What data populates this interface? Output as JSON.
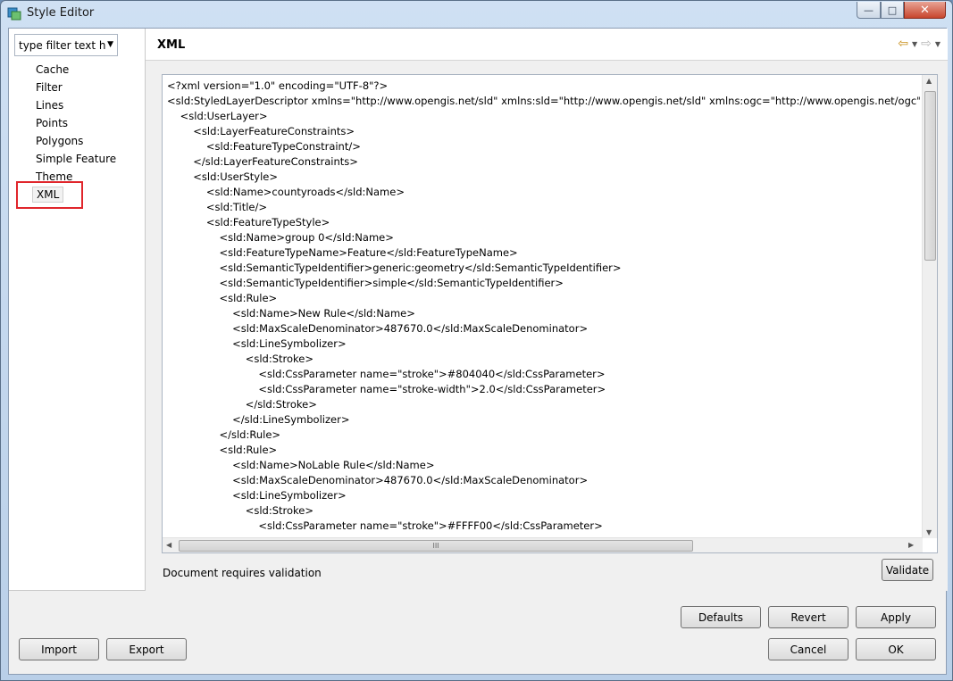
{
  "window": {
    "title": "Style Editor",
    "controls": {
      "minimize": "—",
      "maximize": "□",
      "close": "✕"
    }
  },
  "sidebar": {
    "filter_value": "type filter text h",
    "items": [
      {
        "label": "Cache"
      },
      {
        "label": "Filter"
      },
      {
        "label": "Lines"
      },
      {
        "label": "Points"
      },
      {
        "label": "Polygons"
      },
      {
        "label": "Simple Feature"
      },
      {
        "label": "Theme"
      },
      {
        "label": "XML",
        "selected": true
      }
    ]
  },
  "panel": {
    "title": "XML",
    "nav": {
      "back_icon": "back-arrow-icon",
      "forward_icon": "forward-arrow-icon"
    }
  },
  "editor": {
    "lines": [
      "<?xml version=\"1.0\" encoding=\"UTF-8\"?>",
      "<sld:StyledLayerDescriptor xmlns=\"http://www.opengis.net/sld\" xmlns:sld=\"http://www.opengis.net/sld\" xmlns:ogc=\"http://www.opengis.net/ogc\"",
      "    <sld:UserLayer>",
      "        <sld:LayerFeatureConstraints>",
      "            <sld:FeatureTypeConstraint/>",
      "        </sld:LayerFeatureConstraints>",
      "        <sld:UserStyle>",
      "            <sld:Name>countyroads</sld:Name>",
      "            <sld:Title/>",
      "            <sld:FeatureTypeStyle>",
      "                <sld:Name>group 0</sld:Name>",
      "                <sld:FeatureTypeName>Feature</sld:FeatureTypeName>",
      "                <sld:SemanticTypeIdentifier>generic:geometry</sld:SemanticTypeIdentifier>",
      "                <sld:SemanticTypeIdentifier>simple</sld:SemanticTypeIdentifier>",
      "                <sld:Rule>",
      "                    <sld:Name>New Rule</sld:Name>",
      "                    <sld:MaxScaleDenominator>487670.0</sld:MaxScaleDenominator>",
      "                    <sld:LineSymbolizer>",
      "                        <sld:Stroke>",
      "                            <sld:CssParameter name=\"stroke\">#804040</sld:CssParameter>",
      "                            <sld:CssParameter name=\"stroke-width\">2.0</sld:CssParameter>",
      "                        </sld:Stroke>",
      "                    </sld:LineSymbolizer>",
      "                </sld:Rule>",
      "                <sld:Rule>",
      "                    <sld:Name>NoLable Rule</sld:Name>",
      "                    <sld:MaxScaleDenominator>487670.0</sld:MaxScaleDenominator>",
      "                    <sld:LineSymbolizer>",
      "                        <sld:Stroke>",
      "                            <sld:CssParameter name=\"stroke\">#FFFF00</sld:CssParameter>"
    ]
  },
  "status": "Document requires validation",
  "buttons": {
    "validate": "Validate",
    "defaults": "Defaults",
    "revert": "Revert",
    "apply": "Apply",
    "import": "Import",
    "export": "Export",
    "cancel": "Cancel",
    "ok": "OK"
  },
  "colors": {
    "selection_highlight": "#e0252b",
    "accent_arrow": "#c88f1a"
  }
}
